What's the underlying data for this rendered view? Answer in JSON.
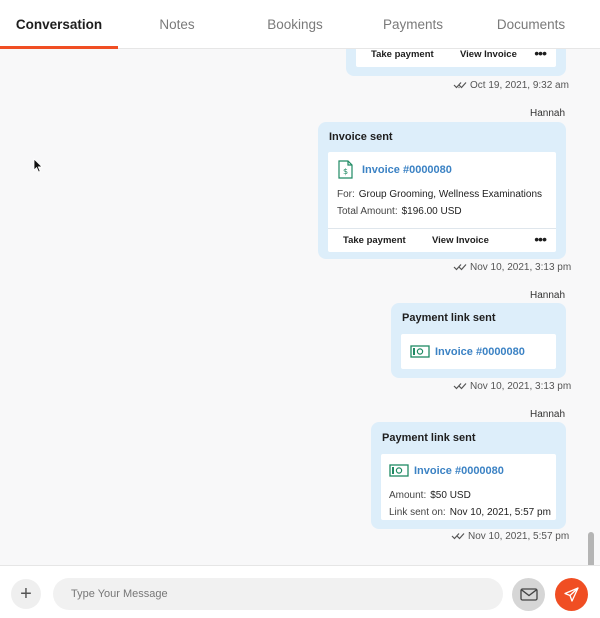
{
  "tabs": [
    {
      "label": "Conversation",
      "active": true
    },
    {
      "label": "Notes",
      "active": false
    },
    {
      "label": "Bookings",
      "active": false
    },
    {
      "label": "Payments",
      "active": false
    },
    {
      "label": "Documents",
      "active": false
    }
  ],
  "messages": [
    {
      "actions": {
        "take_payment": "Take payment",
        "view_invoice": "View Invoice",
        "more": "•••"
      },
      "timestamp": "Oct 19, 2021, 9:32 am"
    },
    {
      "sender": "Hannah",
      "title": "Invoice sent",
      "invoice_link": "Invoice #0000080",
      "for_label": "For:",
      "for_value": "Group Grooming, Wellness Examinations",
      "total_label": "Total Amount:",
      "total_value": "$196.00 USD",
      "actions": {
        "take_payment": "Take payment",
        "view_invoice": "View Invoice",
        "more": "•••"
      },
      "timestamp": "Nov 10, 2021, 3:13 pm"
    },
    {
      "sender": "Hannah",
      "title": "Payment link sent",
      "invoice_link": "Invoice #0000080",
      "timestamp": "Nov 10, 2021, 3:13 pm"
    },
    {
      "sender": "Hannah",
      "title": "Payment link sent",
      "invoice_link": "Invoice #0000080",
      "amount_label": "Amount:",
      "amount_value": "$50 USD",
      "link_sent_label": "Link sent on:",
      "link_sent_value": "Nov 10, 2021, 5:57 pm",
      "timestamp": "Nov 10, 2021, 5:57 pm"
    }
  ],
  "composer": {
    "plus": "+",
    "placeholder": "Type Your Message"
  },
  "colors": {
    "accent": "#f04e23",
    "bubble": "#ddeefa",
    "link": "#3b82c4",
    "money_icon": "#1f8a63"
  }
}
